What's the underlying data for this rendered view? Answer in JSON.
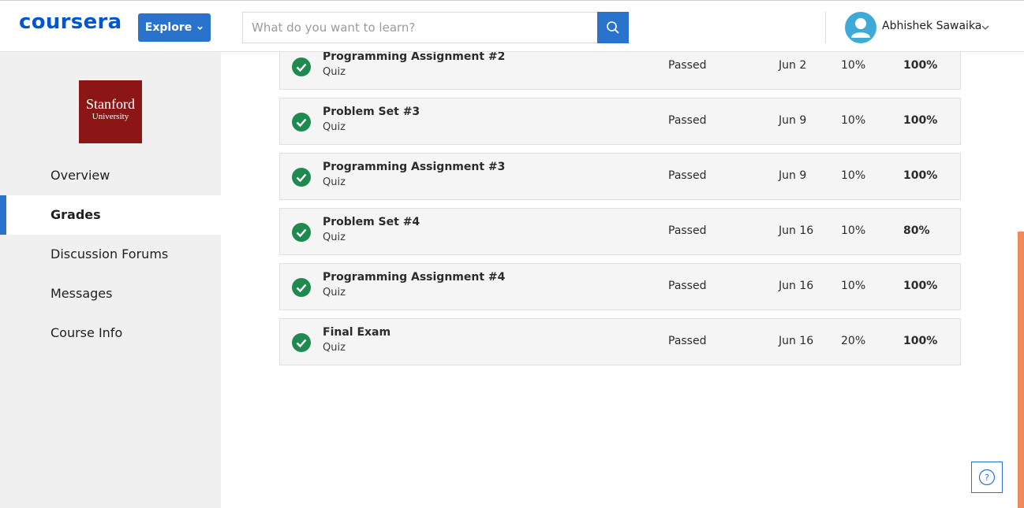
{
  "header": {
    "logo_text": "coursera",
    "explore_label": "Explore",
    "search_placeholder": "What do you want to learn?",
    "search_value": "",
    "user_name": "Abhishek Sawaika",
    "brand_color": "#0056d2",
    "accent_color": "#2a73cc"
  },
  "sidebar": {
    "university": {
      "line1": "Stanford",
      "line2": "University",
      "color": "#8c1515"
    },
    "items": [
      {
        "label": "Overview",
        "active": false
      },
      {
        "label": "Grades",
        "active": true
      },
      {
        "label": "Discussion Forums",
        "active": false
      },
      {
        "label": "Messages",
        "active": false
      },
      {
        "label": "Course Info",
        "active": false
      }
    ]
  },
  "grades": {
    "rows": [
      {
        "title": "Programming Assignment #2",
        "type": "Quiz",
        "status": "Passed",
        "due": "Jun 2",
        "weight": "10%",
        "grade": "100%"
      },
      {
        "title": "Problem Set #3",
        "type": "Quiz",
        "status": "Passed",
        "due": "Jun 9",
        "weight": "10%",
        "grade": "100%"
      },
      {
        "title": "Programming Assignment #3",
        "type": "Quiz",
        "status": "Passed",
        "due": "Jun 9",
        "weight": "10%",
        "grade": "100%"
      },
      {
        "title": "Problem Set #4",
        "type": "Quiz",
        "status": "Passed",
        "due": "Jun 16",
        "weight": "10%",
        "grade": "80%"
      },
      {
        "title": "Programming Assignment #4",
        "type": "Quiz",
        "status": "Passed",
        "due": "Jun 16",
        "weight": "10%",
        "grade": "100%"
      },
      {
        "title": "Final Exam",
        "type": "Quiz",
        "status": "Passed",
        "due": "Jun 16",
        "weight": "20%",
        "grade": "100%"
      }
    ],
    "status_color": "#1e8a50"
  },
  "help": {
    "icon": "question-circle-icon",
    "glyph": "?"
  }
}
